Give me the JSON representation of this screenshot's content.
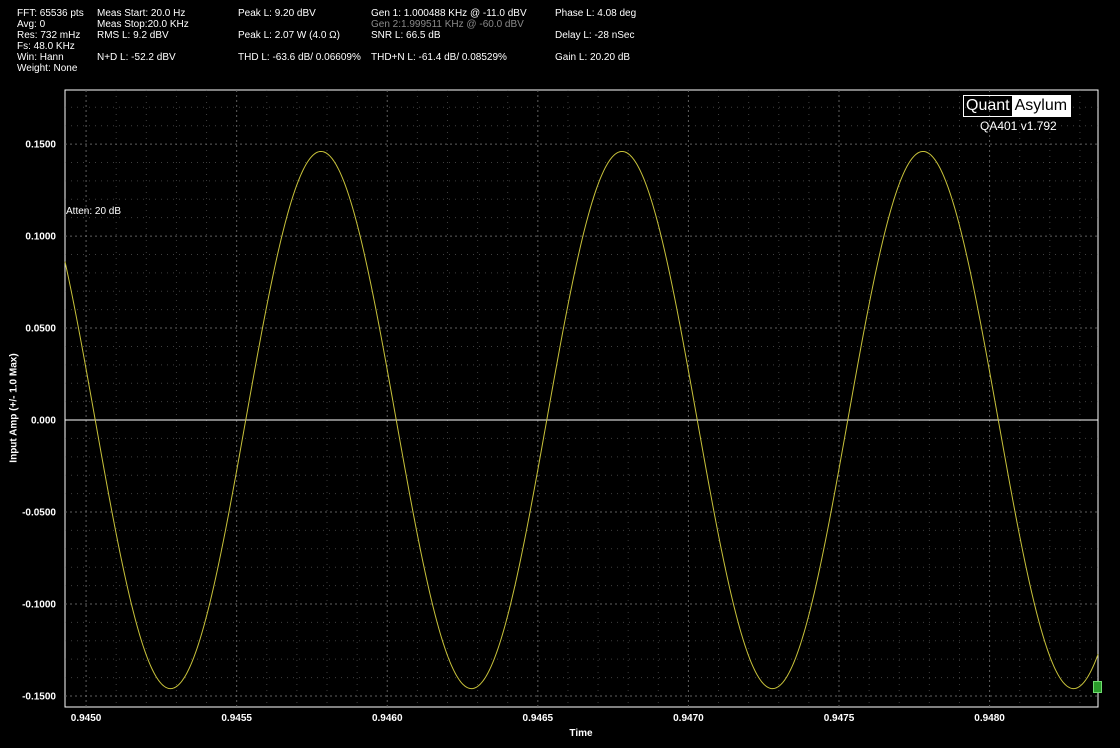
{
  "stats": {
    "fft": "FFT: 65536 pts",
    "avg": "Avg: 0",
    "res": "Res: 732 mHz",
    "fs": "Fs: 48.0 KHz",
    "win": "Win: Hann",
    "weight": "Weight: None",
    "meas_start": "Meas Start: 20.0 Hz",
    "meas_stop": "Meas Stop:20.0 KHz",
    "rms_l": "RMS L: 9.2 dBV",
    "nd_l": "N+D L: -52.2 dBV",
    "peak_l_dbv": "Peak L: 9.20 dBV",
    "peak_l_w": "Peak L: 2.07 W (4.0 Ω)",
    "thd_l": "THD L: -63.6 dB/ 0.06609%",
    "gen1": "Gen 1: 1.000488 KHz @ -11.0  dBV",
    "gen2": "Gen 2:1.999511 KHz @ -60.0  dBV",
    "snr_l": "SNR L: 66.5 dB",
    "thdn_l": "THD+N L: -61.4 dB/ 0.08529%",
    "phase_l": "Phase L: 4.08 deg",
    "delay_l": "Delay L: -28 nSec",
    "gain_l": "Gain L: 20.20 dB"
  },
  "logo": {
    "left": "Quant",
    "right": "Asylum"
  },
  "version": "QA401 v1.792",
  "atten_label": "Atten: 20 dB",
  "colors": {
    "trace": "#c8c23a",
    "grid": "#6a6a6a",
    "axis": "#ffffff",
    "zero_line": "#ffffff"
  },
  "chart_data": {
    "type": "line",
    "xlabel": "Time",
    "ylabel": "Input Amp (+/- 1.0 Max)",
    "xlim": [
      0.94493,
      0.94836
    ],
    "ylim": [
      -0.156,
      0.1794
    ],
    "x_ticks": [
      0.945,
      0.9455,
      0.946,
      0.9465,
      0.947,
      0.9475,
      0.948
    ],
    "x_tick_labels": [
      "0.9450",
      "0.9455",
      "0.9460",
      "0.9465",
      "0.9470",
      "0.9475",
      "0.9480"
    ],
    "y_ticks": [
      0.15,
      0.1,
      0.05,
      0.0,
      -0.05,
      -0.1,
      -0.15
    ],
    "y_tick_labels": [
      "0.1500",
      "0.1000",
      "0.0500",
      "0.000",
      "-0.0500",
      "-0.1000",
      "-0.1500"
    ],
    "grid": true,
    "series": [
      {
        "amplitude": 0.146,
        "frequency_hz": 1000.488,
        "peak_at": 0.94578,
        "offset": 0.0
      }
    ]
  }
}
